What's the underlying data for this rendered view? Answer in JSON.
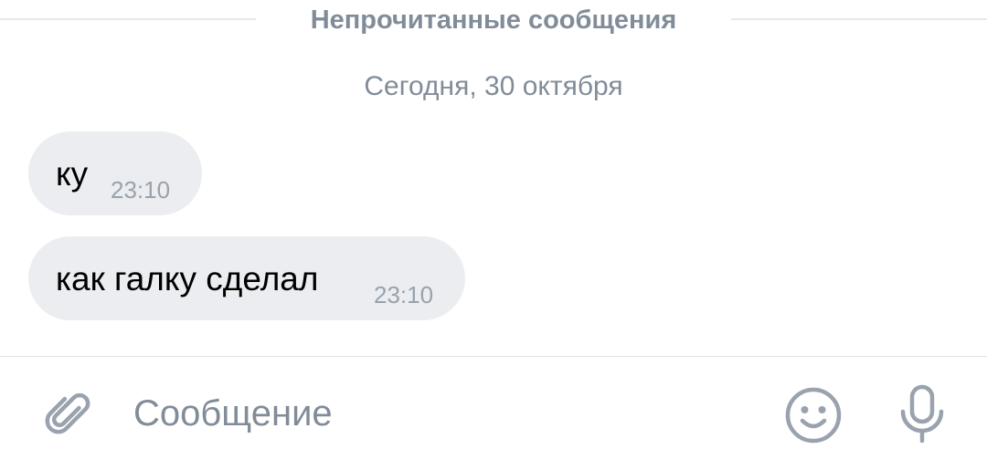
{
  "chat": {
    "unread_label": "Непрочитанные сообщения",
    "date_label": "Сегодня, 30 октября",
    "messages": [
      {
        "text": "ку",
        "time": "23:10"
      },
      {
        "text": "как галку сделал",
        "time": "23:10"
      }
    ]
  },
  "composer": {
    "placeholder": "Сообщение",
    "attach_icon": "paperclip-icon",
    "emoji_icon": "smiley-icon",
    "mic_icon": "microphone-icon"
  },
  "colors": {
    "bubble_bg": "#ebedf0",
    "secondary_text": "#818c99",
    "time_text": "#99a2ad",
    "icon": "#99a2ad"
  }
}
